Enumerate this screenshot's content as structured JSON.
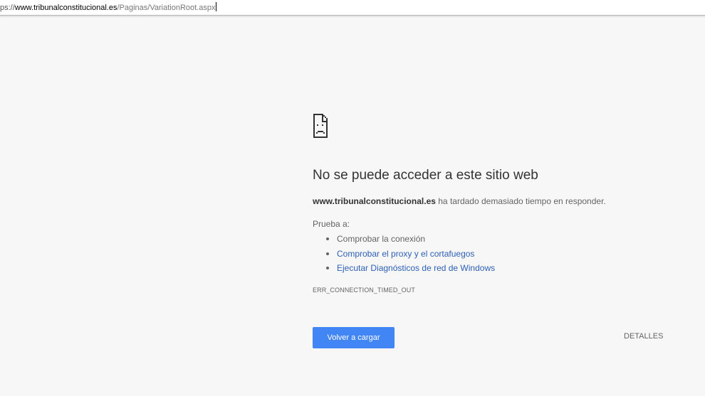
{
  "address_bar": {
    "scheme_fragment": "ps://",
    "host": "www.tribunalconstitucional.es",
    "path": "/Paginas/VariationRoot.aspx"
  },
  "error": {
    "icon": "sad-page-icon",
    "title": "No se puede acceder a este sitio web",
    "domain": "www.tribunalconstitucional.es",
    "summary_suffix": " ha tardado demasiado tiempo en responder.",
    "try_label": "Prueba a:",
    "suggestions": [
      {
        "label": "Comprobar la conexión",
        "link": false
      },
      {
        "label": "Comprobar el proxy y el cortafuegos",
        "link": true
      },
      {
        "label": "Ejecutar Diagnósticos de red de Windows",
        "link": true
      }
    ],
    "code": "ERR_CONNECTION_TIMED_OUT"
  },
  "buttons": {
    "reload": "Volver a cargar",
    "details": "DETALLES"
  },
  "colors": {
    "background": "#f7f7f7",
    "button_blue": "#4285f4",
    "link_blue": "#2c5fb7",
    "text_gray": "#646464"
  }
}
